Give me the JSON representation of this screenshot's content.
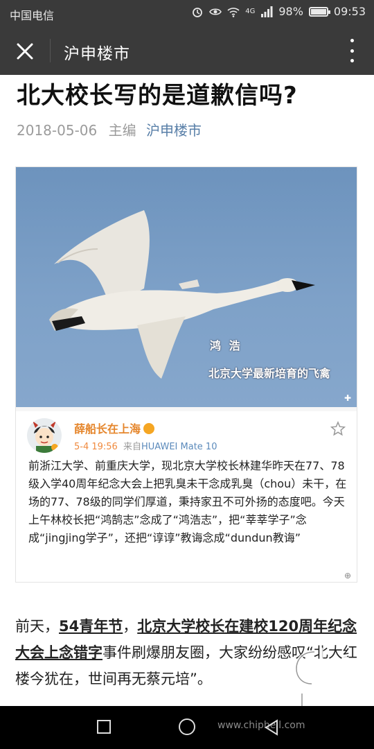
{
  "status_bar": {
    "carrier": "中国电信",
    "signal_type": "4G",
    "battery": "98%",
    "battery_level": 0.98,
    "time": "09:53"
  },
  "title_bar": {
    "title": "沪申楼市"
  },
  "article": {
    "title": "北大校长写的是道歉信吗?",
    "date": "2018-05-06",
    "editor_label": "主编",
    "source": "沪申楼市"
  },
  "image": {
    "caption_line1": "鸿 浩",
    "caption_line2": "北京大学最新培育的飞禽",
    "weibo": {
      "name": "薛船长在上海",
      "time": "5-4 19:56",
      "from_label": "来自",
      "device": "HUAWEI Mate 10",
      "text": "前浙江大学、前重庆大学，现北京大学校长林建华昨天在77、78级入学40周年纪念大会上把乳臭未干念成乳臭（chou）未干，在场的77、78级的同学们厚道，秉持家丑不可外扬的态度吧。今天上午林校长把“鸿鹄志”念成了“鸿浩志”，把“莘莘学子”念成“jingjing学子”，还把“谆谆”教诲念成“dundun教诲”"
    }
  },
  "paragraph": {
    "pre": "前天，",
    "link1": "54青年节",
    "mid": "，",
    "link2": "北京大学校长在建校120周年纪念大会上念错字",
    "post": "事件刷爆朋友圈，大家纷纷感叹“北大红楼今犹在，世间再无蔡元培”。"
  },
  "watermark": {
    "text": "chip hell"
  },
  "nav_bar": {
    "url": "www.chiphell.com"
  },
  "colors": {
    "bar_bg": "#3a3a3a",
    "link_blue": "#577ea7",
    "weibo_orange": "#e5862c"
  }
}
